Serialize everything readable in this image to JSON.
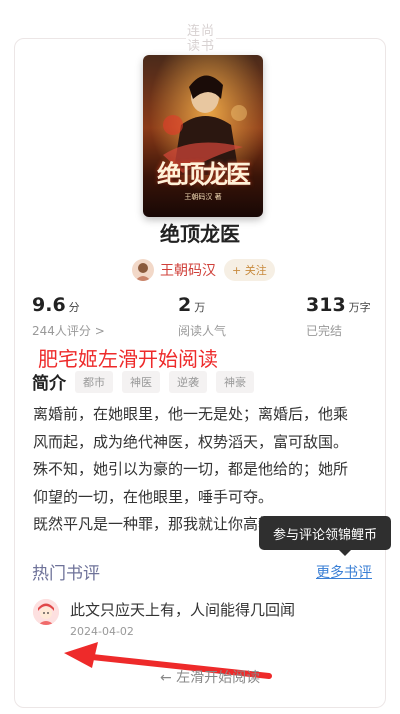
{
  "stamp": {
    "text": "连尚\n读书"
  },
  "book": {
    "title": "绝顶龙医",
    "cover": {
      "title_art": "绝顶龙医",
      "author_line": "王朝码汉 著"
    }
  },
  "author": {
    "name": "王朝码汉",
    "follow_label": "+ 关注"
  },
  "stats": [
    {
      "value": "9.6",
      "unit": "分",
      "sub": "244人评分 >"
    },
    {
      "value": "2",
      "unit": "万",
      "sub": "阅读人气"
    },
    {
      "value": "313",
      "unit": "万字",
      "sub": "已完结"
    }
  ],
  "overlay_banner": "肥宅姬左滑开始阅读",
  "intro": {
    "title": "简介",
    "tags": [
      "都市",
      "神医",
      "逆袭",
      "神豪"
    ],
    "lines": [
      "离婚前，在她眼里，他一无是处；离婚后，他乘",
      "风而起，成为绝代神医，权势滔天，富可敌国。",
      "殊不知，她引以为豪的一切，都是他给的；她所",
      "仰望的一切，在他眼里，唾手可夺。",
      "既然平凡是一种罪，那我就让你高攀不起！"
    ]
  },
  "tooltip": "参与评论领锦鲤币",
  "reviews": {
    "title": "热门书评",
    "more_label": "更多书评",
    "items": [
      {
        "text": "此文只应天上有，人间能得几回闻",
        "date": "2024-04-02"
      }
    ]
  },
  "swipe_hint": "← 左滑开始阅读",
  "colors": {
    "accent_red": "#ee2a2a",
    "link_blue": "#3a7fd5",
    "author_red": "#d0403a"
  }
}
